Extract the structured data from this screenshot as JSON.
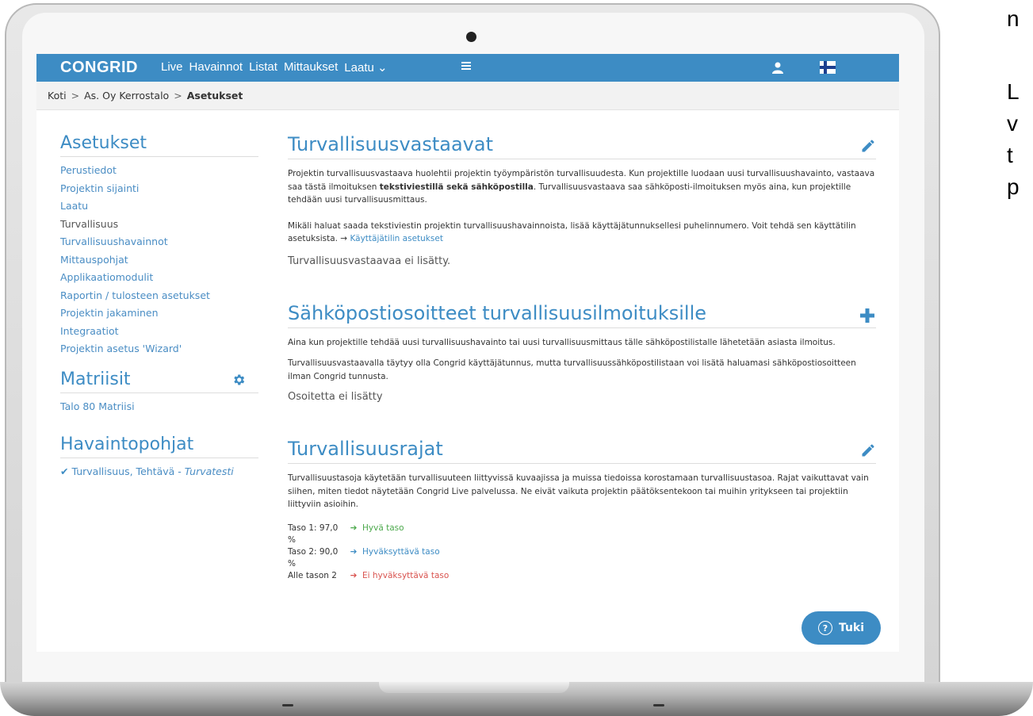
{
  "navbar": {
    "logo": "CONGRID",
    "items": [
      "Live",
      "Havainnot",
      "Listat",
      "Mittaukset",
      "Laatu ⌄"
    ]
  },
  "breadcrumb": {
    "home": "Koti",
    "project": "As. Oy Kerrostalo",
    "current": "Asetukset",
    "sep": ">"
  },
  "sidebar": {
    "settings_title": "Asetukset",
    "links": [
      "Perustiedot",
      "Projektin sijainti",
      "Laatu",
      "Turvallisuus",
      "Turvallisuushavainnot",
      "Mittauspohjat",
      "Applikaatiomodulit",
      "Raportin / tulosteen asetukset",
      "Projektin jakaminen",
      "Integraatiot",
      "Projektin asetus 'Wizard'"
    ],
    "active_link_index": 3,
    "matriisit_title": "Matriisit",
    "matriisit_item": "Talo 80 Matriisi",
    "havainto_title": "Havaintopohjat",
    "havainto_item": "Turvallisuus, Tehtävä - ",
    "havainto_item_italic": "Turvatesti"
  },
  "sections": {
    "vastaavat": {
      "title": "Turvallisuusvastaavat",
      "p1_a": "Projektin turvallisuusvastaava huolehtii projektin työympäristön turvallisuudesta. Kun projektille luodaan uusi turvallisuushavainto, vastaava saa tästä ilmoituksen ",
      "p1_b": "tekstiviestillä sekä sähköpostilla",
      "p1_c": ". Turvallisuusvastaava saa sähköposti-ilmoituksen myös aina, kun projektille tehdään uusi turvallisuusmittaus.",
      "p2": "Mikäli haluat saada tekstiviestin projektin turvallisuushavainnoista, lisää käyttäjätunnuksellesi puhelinnumero. Voit tehdä sen käyttätilin asetuksista. → ",
      "p2_link": "Käyttäjätilin asetukset",
      "empty": "Turvallisuusvastaavaa ei lisätty."
    },
    "emails": {
      "title": "Sähköpostiosoitteet turvallisuusilmoituksille",
      "p1": "Aina kun projektille tehdää uusi turvallisuushavainto tai uusi turvallisuusmittaus tälle sähköpostilistalle lähetetään asiasta ilmoitus.",
      "p2": "Turvallisuusvastaavalla täytyy olla Congrid käyttäjätunnus, mutta turvallisuussähköpostilistaan voi lisätä haluamasi sähköpostiosoitteen ilman Congrid tunnusta.",
      "empty": "Osoitetta ei lisätty"
    },
    "rajat": {
      "title": "Turvallisuusrajat",
      "p1": "Turvallisuustasoja käytetään turvallisuuteen liittyvissä kuvaajissa ja muissa tiedoissa korostamaan turvallisuustasoa. Rajat vaikuttavat vain siihen, miten tiedot näytetään Congrid Live palvelussa. Ne eivät vaikuta projektin päätöksentekoon tai muihin yritykseen tai projektiin liittyviin asioihin.",
      "levels": [
        {
          "label": "Taso 1: 97,0 %",
          "arrow": "➔",
          "text": "Hyvä taso",
          "color": "#4ba84b"
        },
        {
          "label": "Taso 2: 90,0 %",
          "arrow": "➔",
          "text": "Hyväksyttävä taso",
          "color": "#3d8cc4"
        },
        {
          "label": "Alle tason 2",
          "arrow": "➔",
          "text": "Ei hyväksyttävä taso",
          "color": "#d9534f"
        }
      ]
    }
  },
  "tuki": {
    "label": "Tuki",
    "icon": "?"
  },
  "side_text": [
    "n",
    "L",
    "v",
    "t",
    "p"
  ],
  "colors": {
    "brand": "#3d8cc4"
  }
}
